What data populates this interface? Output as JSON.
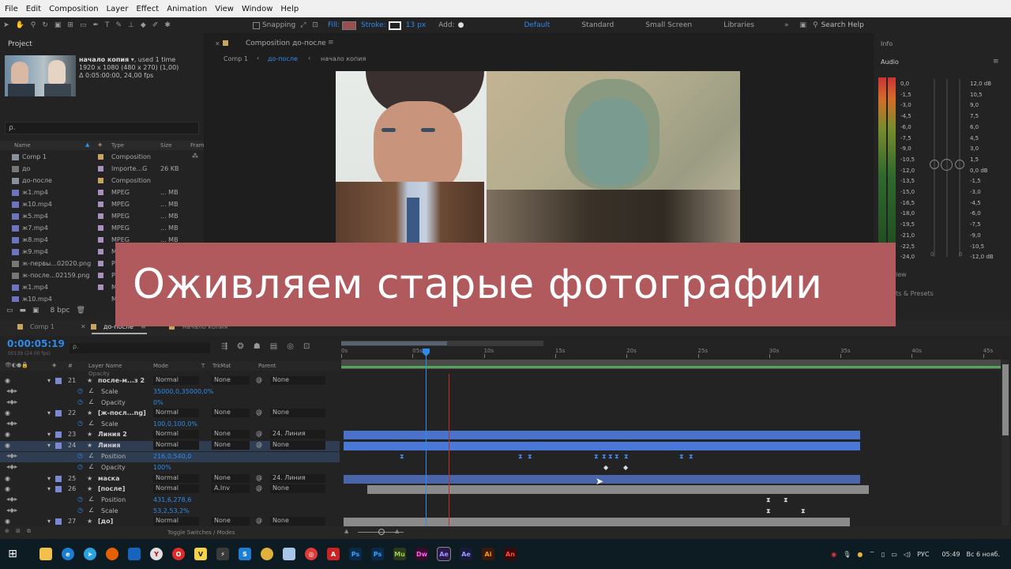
{
  "menubar": {
    "items": [
      "File",
      "Edit",
      "Composition",
      "Layer",
      "Effect",
      "Animation",
      "View",
      "Window",
      "Help"
    ]
  },
  "toolbar": {
    "snapping": "Snapping",
    "fill_label": "Fill:",
    "stroke_label": "Stroke:",
    "stroke_size": "13 px",
    "add_label": "Add:",
    "workspaces": [
      "Default",
      "Standard",
      "Small Screen",
      "Libraries"
    ],
    "search_placeholder": "Search Help"
  },
  "project": {
    "title": "Project",
    "item_name": "начало копия",
    "item_used": ", used 1 time",
    "item_dims": "1920 x 1080  (480 x 270) (1,00)",
    "item_duration": "Δ 0:05:00:00, 24,00 fps",
    "search_placeholder": "ρ.",
    "columns": [
      "Name",
      "Type",
      "Size",
      "Fram"
    ],
    "items": [
      {
        "name": "Comp 1",
        "type": "Composition",
        "size": ""
      },
      {
        "name": "до",
        "type": "Importe...G",
        "size": "26 KB"
      },
      {
        "name": "до-после",
        "type": "Composition",
        "size": ""
      },
      {
        "name": "ж1.mp4",
        "type": "MPEG",
        "size": "... MB"
      },
      {
        "name": "ж10.mp4",
        "type": "MPEG",
        "size": "... MB"
      },
      {
        "name": "ж5.mp4",
        "type": "MPEG",
        "size": "... MB"
      },
      {
        "name": "ж7.mp4",
        "type": "MPEG",
        "size": "... MB"
      },
      {
        "name": "ж8.mp4",
        "type": "MPEG",
        "size": "... MB"
      },
      {
        "name": "ж9.mp4",
        "type": "M",
        "size": ""
      },
      {
        "name": "ж-первы...02020.png",
        "type": "P",
        "size": ""
      },
      {
        "name": "ж-после...02159.png",
        "type": "P",
        "size": ""
      },
      {
        "name": "ж1.mp4",
        "type": "M",
        "size": ""
      },
      {
        "name": "ж10.mp4",
        "type": "M",
        "size": ""
      }
    ],
    "bpc": "8 bpc"
  },
  "composition": {
    "panel_title": "Composition до-после",
    "crumbs": [
      "Comp 1",
      "до-после",
      "начало копия"
    ]
  },
  "right_panel": {
    "info": "Info",
    "audio": "Audio",
    "left_scale": [
      "0,0",
      "-1,5",
      "-3,0",
      "-4,5",
      "-6,0",
      "-7,5",
      "-9,0",
      "-10,5",
      "-12,0",
      "-13,5",
      "-15,0",
      "-16,5",
      "-18,0",
      "-19,5",
      "-21,0",
      "-22,5",
      "-24,0"
    ],
    "right_scale": [
      "12,0 dB",
      "10,5",
      "9,0",
      "7,5",
      "6,0",
      "4,5",
      "3,0",
      "1,5",
      "0,0 dB",
      "-1,5",
      "-3,0",
      "-4,5",
      "-6,0",
      "-7,5",
      "-9,0",
      "-10,5",
      "-12,0 dB"
    ],
    "zero_labels": [
      "0",
      "0"
    ],
    "partial_view": "iew",
    "partial_presets": "ts & Presets"
  },
  "banner": {
    "text": "Оживляем старые фотографии"
  },
  "timeline": {
    "tabs": [
      "Comp 1",
      "до-после",
      "начало копия"
    ],
    "timecode": "0:00:05:19",
    "fps_line": "00139 (24.00 fps)",
    "columns": {
      "layer": "Layer Name",
      "mode": "Mode",
      "t": "T",
      "trkmat": "TrkMat",
      "parent": "Parent"
    },
    "ruler": [
      "0s",
      "05s",
      "10s",
      "15s",
      "20s",
      "25s",
      "30s",
      "35s",
      "40s",
      "45s"
    ],
    "opacity_top": "Opacity",
    "rows": [
      {
        "num": "21",
        "name": "после-м...з 2",
        "mode": "Normal",
        "trk": "None",
        "parent": "None",
        "kind": "layer"
      },
      {
        "name": "Scale",
        "value": "35000,0,35000,0%",
        "kind": "prop"
      },
      {
        "name": "Opacity",
        "value": "0%",
        "kind": "prop"
      },
      {
        "num": "22",
        "name": "[ж-посл...ng]",
        "mode": "Normal",
        "trk": "None",
        "parent": "None",
        "kind": "layer"
      },
      {
        "name": "Scale",
        "value": "100,0,100,0%",
        "kind": "prop"
      },
      {
        "num": "23",
        "name": "Линия 2",
        "mode": "Normal",
        "trk": "None",
        "parent": "24. Линия",
        "kind": "layer"
      },
      {
        "num": "24",
        "name": "Линия",
        "mode": "Normal",
        "trk": "None",
        "parent": "None",
        "kind": "layer"
      },
      {
        "name": "Position",
        "value": "216,0,540,0",
        "kind": "prop"
      },
      {
        "name": "Opacity",
        "value": "100%",
        "kind": "prop"
      },
      {
        "num": "25",
        "name": "маска",
        "mode": "Normal",
        "trk": "None",
        "parent": "24. Линия",
        "kind": "layer"
      },
      {
        "num": "26",
        "name": "[после]",
        "mode": "Normal",
        "trk": "A.Inv",
        "parent": "None",
        "kind": "layer"
      },
      {
        "name": "Position",
        "value": "431,6,278,6",
        "kind": "prop"
      },
      {
        "name": "Scale",
        "value": "53,2,53,2%",
        "kind": "prop"
      },
      {
        "num": "27",
        "name": "[до]",
        "mode": "Normal",
        "trk": "None",
        "parent": "None",
        "kind": "layer"
      }
    ],
    "toggle": "Toggle Switches / Modes"
  },
  "taskbar": {
    "lang": "РУС",
    "time": "05:49",
    "date": "Вс 6 нояб."
  }
}
